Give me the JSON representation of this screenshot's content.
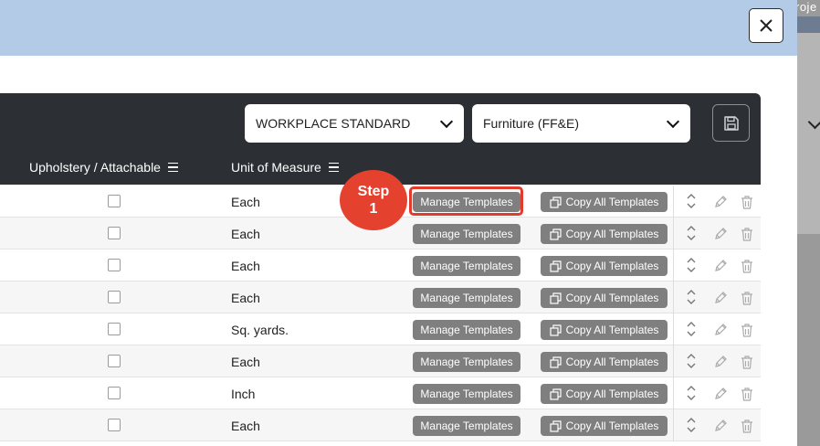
{
  "background": {
    "project_label": "roje"
  },
  "modal": {
    "close_label": "×"
  },
  "toolbar": {
    "standard_select": "WORKPLACE STANDARD",
    "category_select": "Furniture (FF&E)"
  },
  "columns": {
    "upholstery": "Upholstery / Attachable",
    "unit_of_measure": "Unit of Measure"
  },
  "rows": [
    {
      "unit": "Each",
      "manage": "Manage Templates",
      "copy": "Copy All Templates"
    },
    {
      "unit": "Each",
      "manage": "Manage Templates",
      "copy": "Copy All Templates"
    },
    {
      "unit": "Each",
      "manage": "Manage Templates",
      "copy": "Copy All Templates"
    },
    {
      "unit": "Each",
      "manage": "Manage Templates",
      "copy": "Copy All Templates"
    },
    {
      "unit": "Sq. yards.",
      "manage": "Manage Templates",
      "copy": "Copy All Templates"
    },
    {
      "unit": "Each",
      "manage": "Manage Templates",
      "copy": "Copy All Templates"
    },
    {
      "unit": "Inch",
      "manage": "Manage Templates",
      "copy": "Copy All Templates"
    },
    {
      "unit": "Each",
      "manage": "Manage Templates",
      "copy": "Copy All Templates"
    }
  ],
  "annotation": {
    "step_word": "Step",
    "step_number": "1"
  },
  "colors": {
    "banner": "#b4cbe7",
    "header": "#2c3034",
    "button": "#7f7f7f",
    "annotation": "#e5412f"
  },
  "icons": [
    "close-icon",
    "chevron-down-icon",
    "save-icon",
    "column-menu-icon",
    "copy-icon",
    "sort-icon",
    "edit-icon",
    "delete-icon"
  ]
}
